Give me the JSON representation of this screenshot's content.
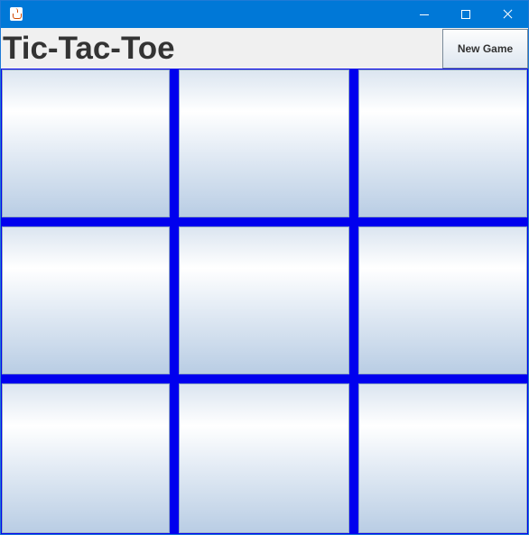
{
  "window": {
    "controls": {
      "minimize_icon": "minimize-icon",
      "maximize_icon": "maximize-icon",
      "close_icon": "close-icon"
    },
    "app_icon": "java-cup-icon",
    "title": ""
  },
  "header": {
    "title": "Tic-Tac-Toe",
    "new_game_label": "New Game"
  },
  "board": {
    "rows": 3,
    "cols": 3,
    "cells": [
      "",
      "",
      "",
      "",
      "",
      "",
      "",
      "",
      ""
    ],
    "grid_color": "#0000ee"
  },
  "colors": {
    "titlebar": "#0078d7",
    "title_text": "#333333"
  }
}
